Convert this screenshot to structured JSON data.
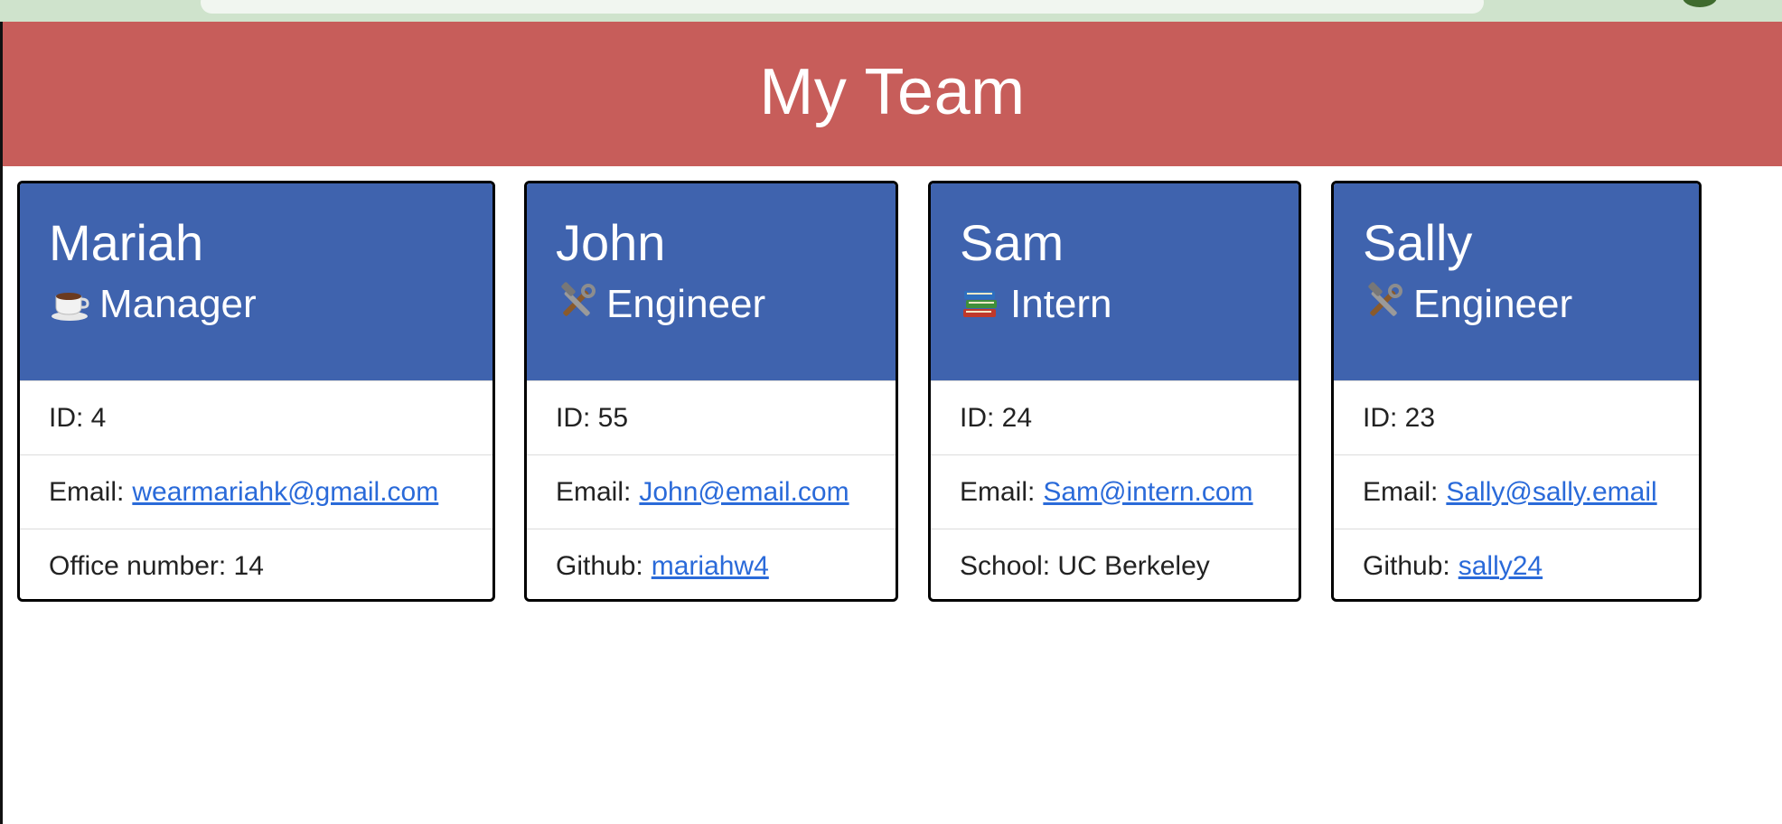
{
  "header": {
    "title": "My Team"
  },
  "employees": [
    {
      "name": "Mariah",
      "role": "Manager",
      "role_icon": "coffee-icon",
      "id_label": "ID: 4",
      "email_prefix": "Email:",
      "email": "wearmariahk@gmail.com",
      "extra_prefix": "Office number: 14",
      "extra_link": ""
    },
    {
      "name": "John",
      "role": "Engineer",
      "role_icon": "tools-icon",
      "id_label": "ID: 55",
      "email_prefix": "Email:",
      "email": "John@email.com",
      "extra_prefix": "Github:",
      "extra_link": "mariahw4"
    },
    {
      "name": "Sam",
      "role": "Intern",
      "role_icon": "books-icon",
      "id_label": "ID: 24",
      "email_prefix": "Email:",
      "email": "Sam@intern.com",
      "extra_prefix": "School: UC Berkeley",
      "extra_link": ""
    },
    {
      "name": "Sally",
      "role": "Engineer",
      "role_icon": "tools-icon",
      "id_label": "ID: 23",
      "email_prefix": "Email:",
      "email": "Sally@sally.email",
      "extra_prefix": "Github:",
      "extra_link": "sally24"
    }
  ],
  "colors": {
    "header_bg": "#c75d5a",
    "card_header_bg": "#3f63ae",
    "link": "#2a6ad9"
  }
}
